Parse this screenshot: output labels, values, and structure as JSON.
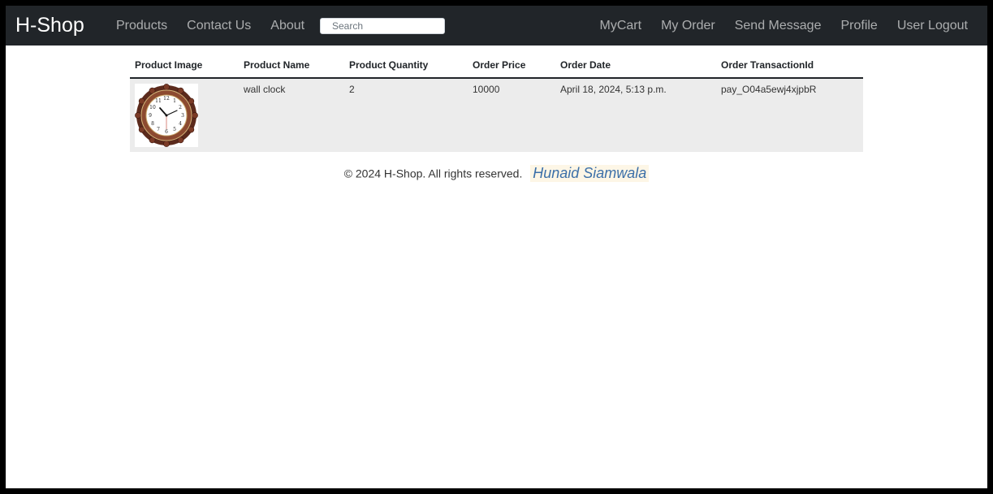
{
  "navbar": {
    "brand": "H-Shop",
    "left_links": [
      "Products",
      "Contact Us",
      "About"
    ],
    "search": {
      "placeholder": "Search",
      "value": ""
    },
    "right_links": [
      "MyCart",
      "My Order",
      "Send Message",
      "Profile",
      "User Logout"
    ]
  },
  "orders_table": {
    "headers": [
      "Product Image",
      "Product Name",
      "Product Quantity",
      "Order Price",
      "Order Date",
      "Order TransactionId"
    ],
    "rows": [
      {
        "image_icon": "wall-clock-image",
        "name": "wall clock",
        "quantity": "2",
        "price": "10000",
        "date": "April 18, 2024, 5:13 p.m.",
        "transaction_id": "pay_O04a5ewj4xjpbR"
      }
    ]
  },
  "footer": {
    "copyright": "© 2024 H-Shop. All rights reserved.",
    "author": "Hunaid Siamwala"
  },
  "colors": {
    "navbar_bg": "#212529",
    "row_bg": "#ececec",
    "author_color": "#3b6fa8"
  }
}
